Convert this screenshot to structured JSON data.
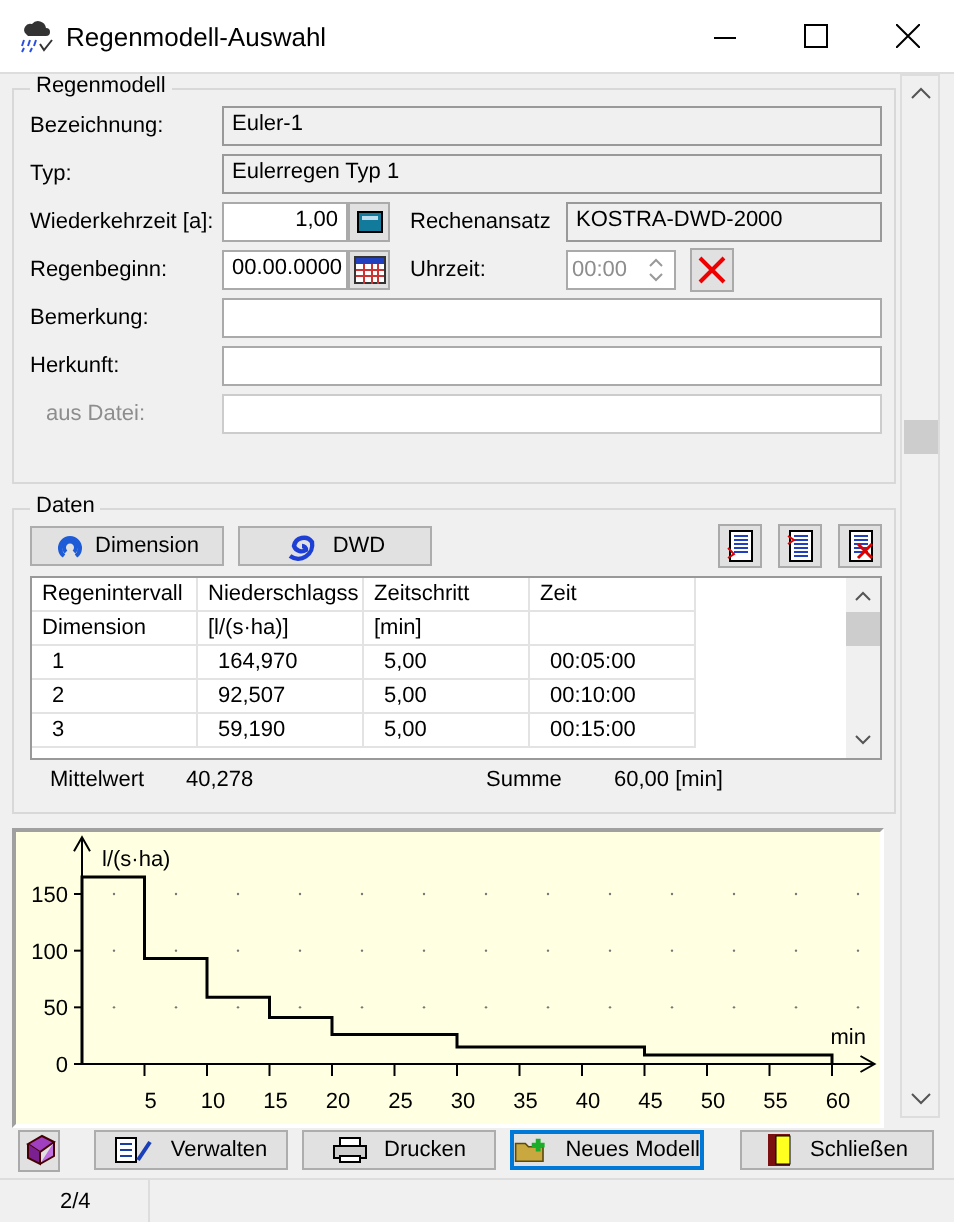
{
  "window": {
    "title": "Regenmodell-Auswahl"
  },
  "regenmodell": {
    "title": "Regenmodell",
    "bezeichnung": {
      "label": "Bezeichnung:",
      "value": "Euler-1"
    },
    "typ": {
      "label": "Typ:",
      "value": "Eulerregen Typ 1"
    },
    "wiederkehrzeit": {
      "label": "Wiederkehrzeit  [a]:",
      "value": "1,00"
    },
    "rechenansatz": {
      "label": "Rechenansatz",
      "value": "KOSTRA-DWD-2000"
    },
    "regenbeginn": {
      "label": "Regenbeginn:",
      "value": "00.00.0000"
    },
    "uhrzeit": {
      "label": "Uhrzeit:",
      "value": "00:00",
      "disabled": true
    },
    "bemerkung": {
      "label": "Bemerkung:"
    },
    "herkunft": {
      "label": "Herkunft:"
    },
    "aus_datei": {
      "label": "aus Datei:",
      "disabled": true
    }
  },
  "daten": {
    "title": "Daten",
    "buttons": [
      {
        "label": "Dimension",
        "kind": "dimension"
      },
      {
        "label": "DWD",
        "kind": "dwd"
      }
    ],
    "table": {
      "columns": [
        "Regenintervall",
        "Niederschlagss",
        "Zeitschritt",
        "Zeit"
      ],
      "units": [
        "Dimension",
        "[l/(s·ha)]",
        "[min]"
      ],
      "rows": [
        [
          "1",
          "164,970",
          "5,00",
          "00:05:00"
        ],
        [
          "2",
          "92,507",
          "5,00",
          "00:10:00"
        ],
        [
          "3",
          "59,190",
          "5,00",
          "00:15:00"
        ]
      ]
    },
    "mittelwert": {
      "label": "Mittelwert",
      "value": "40,278"
    },
    "summe": {
      "label": "Summe",
      "value": "60,00 [min]"
    }
  },
  "chart": {
    "chart_data": {
      "type": "line",
      "ylabel": "l/(s·ha)",
      "xlabel": "min",
      "x": [
        0,
        0,
        5,
        5,
        10,
        10,
        15,
        15,
        20,
        20,
        30,
        30,
        45,
        45,
        60,
        60
      ],
      "series": [
        {
          "color": "#000000",
          "values": [
            0,
            165,
            165,
            93,
            93,
            59,
            59,
            41,
            41,
            26,
            26,
            15,
            15,
            8,
            8,
            0
          ]
        }
      ],
      "xlim": [
        0,
        63.4
      ],
      "ylim": [
        0,
        200
      ],
      "xticks": [
        5,
        10,
        15,
        20,
        25,
        30,
        35,
        40,
        45,
        50,
        55,
        60
      ],
      "yticks": [
        0,
        50,
        100,
        150
      ]
    }
  },
  "buttons": [
    {
      "label": "Verwalten",
      "kind": "verwalten",
      "focused": false
    },
    {
      "label": "Drucken",
      "kind": "drucken",
      "focused": false
    },
    {
      "label": "Neues Modell",
      "kind": "neu",
      "focused": true
    },
    {
      "label": "Schließen",
      "kind": "schliessen",
      "focused": false
    }
  ],
  "status_bar": {
    "page": "2/4"
  }
}
